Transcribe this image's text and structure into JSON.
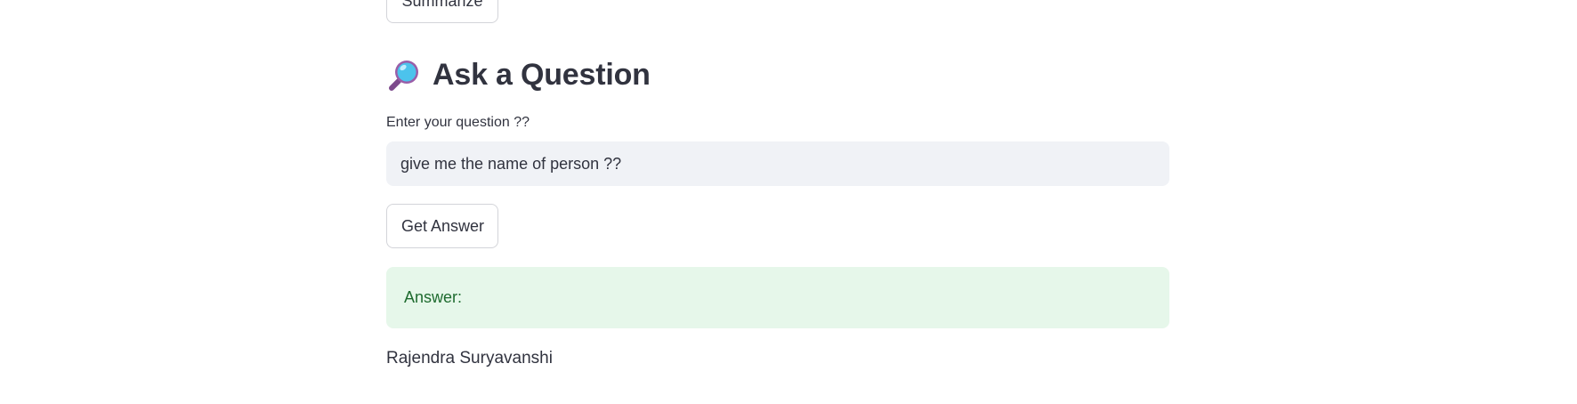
{
  "actions": {
    "summarize_label": "Summarize"
  },
  "qa_section": {
    "title": "Ask a Question",
    "title_icon": "magnifying-glass-icon",
    "input_label": "Enter your question ??",
    "input_value": "give me the name of person ??",
    "submit_label": "Get Answer",
    "answer_label": "Answer:",
    "answer_text": "Rajendra Suryavanshi"
  },
  "colors": {
    "text": "#31333f",
    "input_background": "#f0f2f6",
    "success_background": "#e6f7ea",
    "success_text": "#1e6b2f",
    "button_border": "#d3d4d9"
  }
}
